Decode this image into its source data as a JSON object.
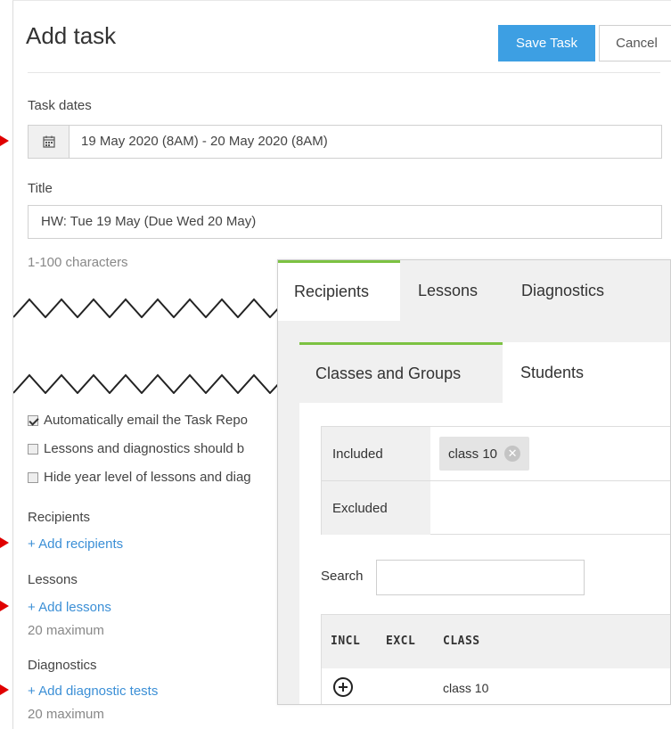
{
  "header": {
    "title": "Add task",
    "save_label": "Save Task",
    "cancel_label": "Cancel"
  },
  "task_dates": {
    "label": "Task dates",
    "value": "19 May 2020 (8AM) - 20 May 2020 (8AM)"
  },
  "title_field": {
    "label": "Title",
    "value": "HW: Tue 19 May (Due Wed 20 May)",
    "hint": "1-100 characters"
  },
  "options": [
    {
      "label": "Automatically email the Task Repo",
      "checked": true
    },
    {
      "label": "Lessons and diagnostics should b",
      "checked": false
    },
    {
      "label": "Hide year level of lessons and diag",
      "checked": false
    }
  ],
  "recipients": {
    "label": "Recipients",
    "link": "+ Add recipients"
  },
  "lessons": {
    "label": "Lessons",
    "link": "+ Add lessons",
    "hint": "20 maximum"
  },
  "diagnostics": {
    "label": "Diagnostics",
    "link": "+ Add diagnostic tests",
    "hint": "20 maximum"
  },
  "panel": {
    "tabs": [
      "Recipients",
      "Lessons",
      "Diagnostics"
    ],
    "subtabs": [
      "Classes and Groups",
      "Students"
    ],
    "included_label": "Included",
    "excluded_label": "Excluded",
    "included_chip": "class 10",
    "search_label": "Search",
    "table": {
      "headers": [
        "INCL",
        "EXCL",
        "CLASS"
      ],
      "rows": [
        {
          "class": "class 10"
        }
      ]
    }
  },
  "colors": {
    "accent": "#3d9fe3",
    "tab_active": "#7cc242",
    "link": "#3b8fd6",
    "arrow": "#e00000"
  }
}
